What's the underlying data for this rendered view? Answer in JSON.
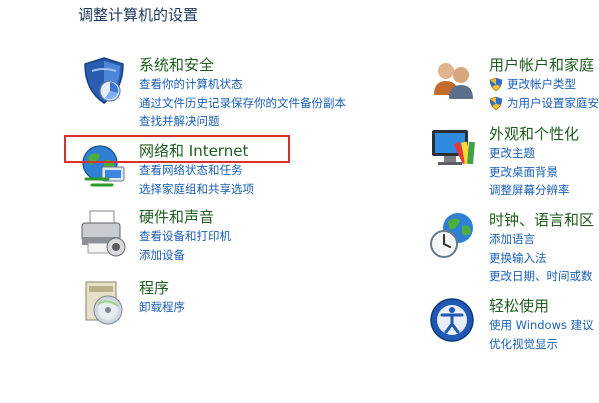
{
  "page_heading": "调整计算机的设置",
  "categories": [
    {
      "id": "system-security",
      "icon": "shield-icon",
      "title": "系统和安全",
      "links": [
        "查看你的计算机状态",
        "通过文件历史记录保存你的文件备份副本",
        "查找并解决问题"
      ]
    },
    {
      "id": "network-internet",
      "icon": "globe-network-icon",
      "title": "网络和 Internet",
      "links": [
        "查看网络状态和任务",
        "选择家庭组和共享选项"
      ]
    },
    {
      "id": "hardware-sound",
      "icon": "printer-icon",
      "title": "硬件和声音",
      "links": [
        "查看设备和打印机",
        "添加设备"
      ]
    },
    {
      "id": "programs",
      "icon": "programs-icon",
      "title": "程序",
      "links": [
        "卸载程序"
      ]
    },
    {
      "id": "user-accounts",
      "icon": "users-icon",
      "title": "用户帐户和家庭",
      "links": [
        "更改帐户类型",
        "为用户设置家庭安"
      ]
    },
    {
      "id": "appearance",
      "icon": "monitor-palette-icon",
      "title": "外观和个性化",
      "links": [
        "更改主题",
        "更改桌面背景",
        "调整屏幕分辨率"
      ]
    },
    {
      "id": "clock-language",
      "icon": "clock-globe-icon",
      "title": "时钟、语言和区",
      "links": [
        "添加语言",
        "更换输入法",
        "更改日期、时间或数"
      ]
    },
    {
      "id": "ease-of-access",
      "icon": "ease-of-access-icon",
      "title": "轻松使用",
      "links": [
        "使用 Windows 建议",
        "优化视觉显示"
      ]
    }
  ],
  "highlight": {
    "target": "network-internet",
    "color": "#d9312f"
  },
  "colors": {
    "title_green": "#1e5d1e",
    "link_blue": "#1a5fb4"
  }
}
